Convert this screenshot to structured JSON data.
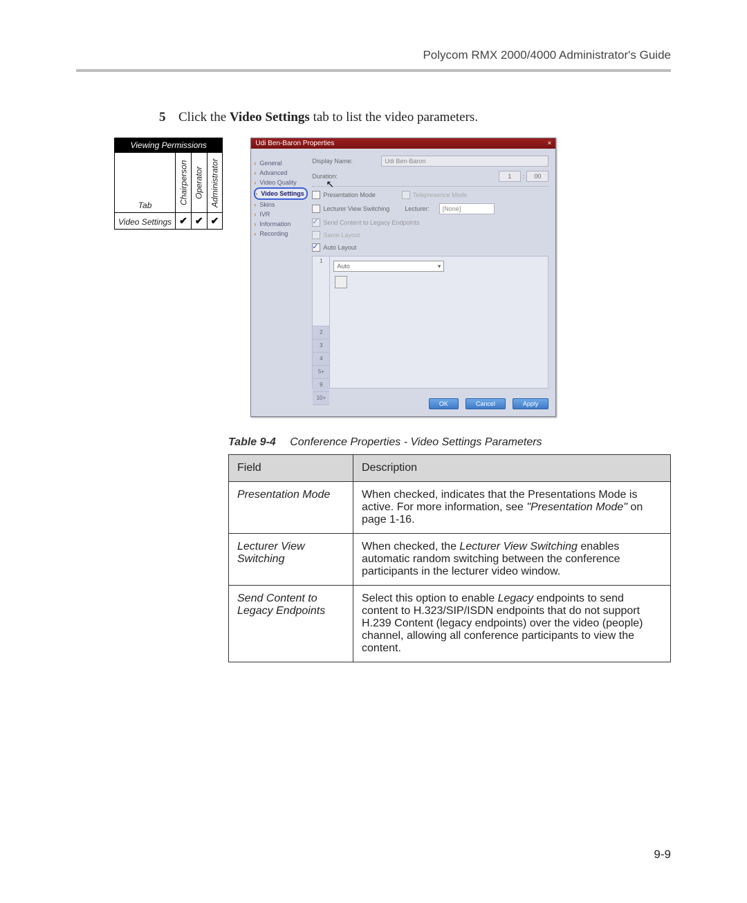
{
  "header": {
    "title": "Polycom RMX 2000/4000 Administrator's Guide"
  },
  "step": {
    "number": "5",
    "text_prefix": "Click the ",
    "text_bold": "Video Settings",
    "text_suffix": " tab to list the video parameters."
  },
  "permissions": {
    "caption": "Viewing Permissions",
    "col_tab": "Tab",
    "col_chair": "Chairperson",
    "col_operator": "Operator",
    "col_admin": "Administrator",
    "row_label": "Video Settings",
    "chair": "✔",
    "operator": "✔",
    "admin": "✔"
  },
  "dialog": {
    "title": "Udi Ben-Baron Properties",
    "close": "×",
    "nav": {
      "general": "General",
      "advanced": "Advanced",
      "video_quality": "Video Quality",
      "video_settings": "Video Settings",
      "skins": "Skins",
      "ivr": "IVR",
      "information": "Information",
      "recording": "Recording"
    },
    "form": {
      "display_name_label": "Display Name:",
      "display_name_value": "Udi Ben-Baron",
      "duration_label": "Duration:",
      "duration_h": "1",
      "duration_sep": ":",
      "duration_m": "00",
      "presentation_mode": "Presentation Mode",
      "telepresence_mode": "Telepresence Mode",
      "lecturer_view_switching": "Lecturer View Switching",
      "lecturer_label": "Lecturer:",
      "lecturer_value": "[None]",
      "send_content": "Send Content to Legacy Endpoints",
      "same_layout": "Same Layout",
      "auto_layout": "Auto Layout",
      "tabs": {
        "t1": "1",
        "t2": "2",
        "t3": "3",
        "t4": "4",
        "t5": "5+",
        "t6": "9",
        "t7": "10+"
      },
      "auto_select": "Auto",
      "dropdown_arrow": "▾"
    },
    "buttons": {
      "ok": "OK",
      "cancel": "Cancel",
      "apply": "Apply"
    }
  },
  "table": {
    "caption_label": "Table 9-4",
    "caption_title": "Conference Properties - Video Settings Parameters",
    "head_field": "Field",
    "head_desc": "Description",
    "rows": [
      {
        "field": "Presentation Mode",
        "desc_pre": "When checked, indicates that the Presentations Mode is active. For more information, see ",
        "desc_ref": "\"Presentation Mode\"",
        "desc_post": " on page 1-16."
      },
      {
        "field": "Lecturer View Switching",
        "desc_pre": "When checked, the ",
        "desc_ref": "Lecturer View Switching",
        "desc_post": " enables automatic random switching between the conference participants in the lecturer video window."
      },
      {
        "field": "Send Content to Legacy Endpoints",
        "desc_pre": "Select this option to enable ",
        "desc_ref": "Legacy",
        "desc_post": " endpoints to send content to H.323/SIP/ISDN endpoints that do not support H.239 Content (legacy endpoints) over the video (people) channel, allowing all conference participants to view the content."
      }
    ]
  },
  "page_number": "9-9"
}
